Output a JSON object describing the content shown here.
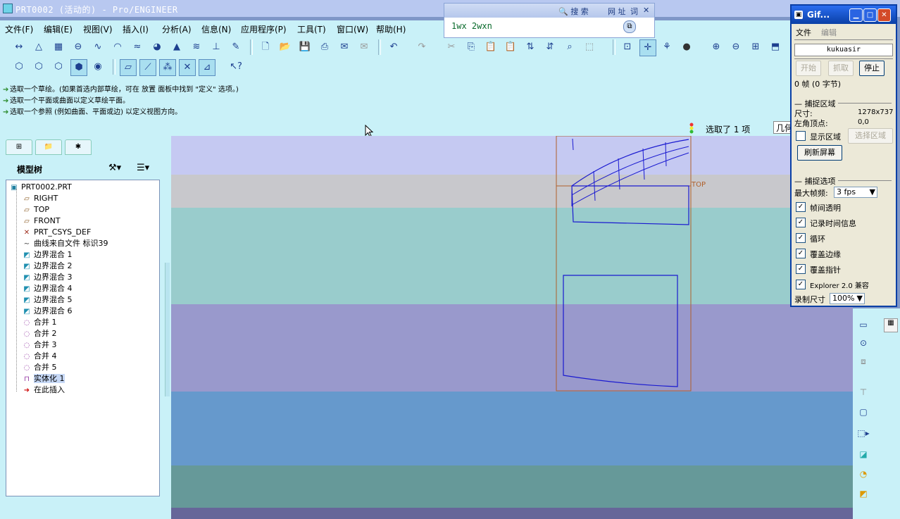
{
  "window": {
    "title": "PRT0002 (活动的) - Pro/ENGINEER"
  },
  "searchbar": {
    "search_label": "搜 索",
    "url_label": "网 址",
    "word_label": "词",
    "query": "1wx 2wxn"
  },
  "menu": [
    "文件(F)",
    "编辑(E)",
    "视图(V)",
    "插入(I)",
    "分析(A)",
    "信息(N)",
    "应用程序(P)",
    "工具(T)",
    "窗口(W)",
    "帮助(H)"
  ],
  "messages": [
    "选取一个草绘。(如果首选内部草绘，可在 放置 面板中找到 \"定义\" 选项。)",
    "选取一个平面或曲面以定义草绘平面。",
    "选取一个参照 (例如曲面、平面或边) 以定义视图方向。"
  ],
  "status": {
    "selection": "选取了 1 项",
    "filter": "几何"
  },
  "model_tree": {
    "label": "模型树",
    "nodes": [
      {
        "icon": "part-icon",
        "label": "PRT0002.PRT"
      },
      {
        "icon": "datum-plane-icon",
        "label": "RIGHT"
      },
      {
        "icon": "datum-plane-icon",
        "label": "TOP"
      },
      {
        "icon": "datum-plane-icon",
        "label": "FRONT"
      },
      {
        "icon": "csys-icon",
        "label": "PRT_CSYS_DEF"
      },
      {
        "icon": "curve-icon",
        "label": "曲线来自文件 标识39"
      },
      {
        "icon": "boundary-blend-icon",
        "label": "边界混合 1"
      },
      {
        "icon": "boundary-blend-icon",
        "label": "边界混合 2"
      },
      {
        "icon": "boundary-blend-icon",
        "label": "边界混合 3"
      },
      {
        "icon": "boundary-blend-icon",
        "label": "边界混合 4"
      },
      {
        "icon": "boundary-blend-icon",
        "label": "边界混合 5"
      },
      {
        "icon": "boundary-blend-icon",
        "label": "边界混合 6"
      },
      {
        "icon": "merge-icon",
        "label": "合并 1"
      },
      {
        "icon": "merge-icon",
        "label": "合并 2"
      },
      {
        "icon": "merge-icon",
        "label": "合并 3"
      },
      {
        "icon": "merge-icon",
        "label": "合并 4"
      },
      {
        "icon": "merge-icon",
        "label": "合并 5"
      },
      {
        "icon": "solidify-icon",
        "label": "实体化 1"
      },
      {
        "icon": "insert-here-icon",
        "label": "在此插入"
      }
    ]
  },
  "canvas": {
    "datum_label": "TOP",
    "bands": [
      "#C5C9F2",
      "#C8C8CC",
      "#99CCCC",
      "#9999CC",
      "#6699CC",
      "#669999",
      "#666699"
    ]
  },
  "gif_tool": {
    "title": "Gif...",
    "menu_file": "文件",
    "menu_edit": "编辑",
    "name": "kukuasir",
    "btn_start": "开始",
    "btn_capture": "抓取",
    "btn_stop": "停止",
    "frames": "0 帧 (0 字节)",
    "section_capture": "捕捉区域",
    "size_label": "尺寸:",
    "size_value": "1278x737",
    "corner_label": "左角顶点:",
    "corner_value": "0,0",
    "show_area": "显示区域",
    "select_area": "选择区域",
    "refresh": "刷新屏幕",
    "section_options": "捕捉选项",
    "max_fps_label": "最大帧频:",
    "max_fps_value": "3 fps",
    "opt_transparent": "帧间透明",
    "opt_timeinfo": "记录时间信息",
    "opt_loop": "循环",
    "opt_cover_edge": "覆盖边缘",
    "opt_cover_pointer": "覆盖指针",
    "opt_explorer": "Explorer 2.0 兼容",
    "rec_size_label": "录制尺寸",
    "rec_size_value": "100%"
  }
}
